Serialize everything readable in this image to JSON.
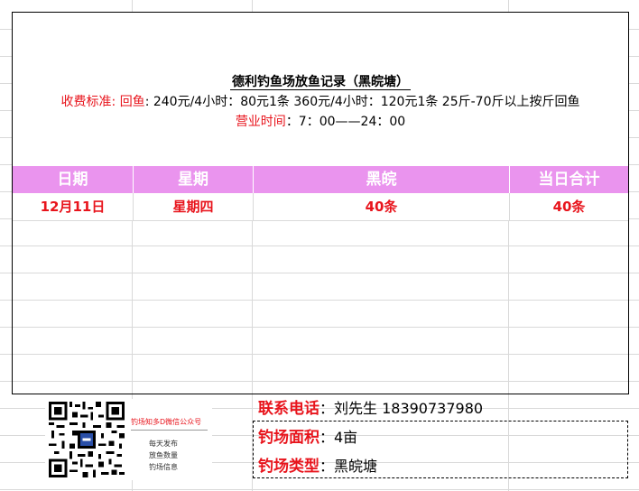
{
  "header": {
    "title": "德利钓鱼场放鱼记录（黑皖塘）",
    "fee_label": "收费标准: ",
    "fee_type": "回鱼",
    "fee_colon": ": ",
    "fee_text": "240元/4小时：80元1条  360元/4小时：120元1条 25斤-70斤以上按斤回鱼",
    "hours_label": "营业时间",
    "hours_text": "：7：00——24：00"
  },
  "table": {
    "columns": [
      "日期",
      "星期",
      "黑皖",
      "当日合计"
    ],
    "rows": [
      [
        "12月11日",
        "星期四",
        "40条",
        "40条"
      ]
    ]
  },
  "qr_card": {
    "title": "钓场知多D微信公众号",
    "lines": [
      "每天发布",
      "放鱼数量",
      "钓场信息"
    ]
  },
  "contact": {
    "phone_label": "联系电话",
    "phone_value": "：刘先生 18390737980",
    "area_label": "钓场面积",
    "area_value": "：4亩",
    "type_label": "钓场类型",
    "type_value": "：黑皖塘"
  },
  "colors": {
    "header_bg": "#ea94ee",
    "accent_red": "#e8141c"
  }
}
